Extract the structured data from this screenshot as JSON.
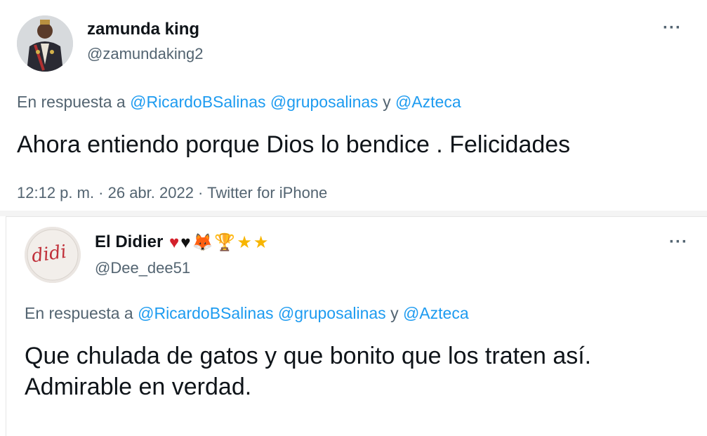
{
  "tweets": [
    {
      "display_name": "zamunda king",
      "handle": "@zamundaking2",
      "reply_prefix": "En respuesta a",
      "mention1": "@RicardoBSalinas",
      "mention2": "@gruposalinas",
      "reply_join": "y",
      "mention3": "@Azteca",
      "text": "Ahora entiendo porque Dios lo bendice . Felicidades",
      "meta": "12:12 p. m. · 26 abr. 2022 · Twitter for iPhone",
      "more_label": "···"
    },
    {
      "display_name": "El Didier",
      "handle": "@Dee_dee51",
      "reply_prefix": "En respuesta a",
      "mention1": "@RicardoBSalinas",
      "mention2": "@gruposalinas",
      "reply_join": "y",
      "mention3": "@Azteca",
      "text_line1": "Que chulada de gatos y que bonito que los traten así.",
      "text_line2": "Admirable en verdad.",
      "more_label": "···",
      "emojis": {
        "heart_red": "♥",
        "heart_black": "♥",
        "fox": "🦊",
        "trophy": "🏆",
        "star1": "★",
        "star2": "★"
      },
      "avatar_text": "didi"
    }
  ],
  "colors": {
    "link": "#1d9bf0",
    "secondary": "#536471",
    "text": "#0f1419"
  }
}
